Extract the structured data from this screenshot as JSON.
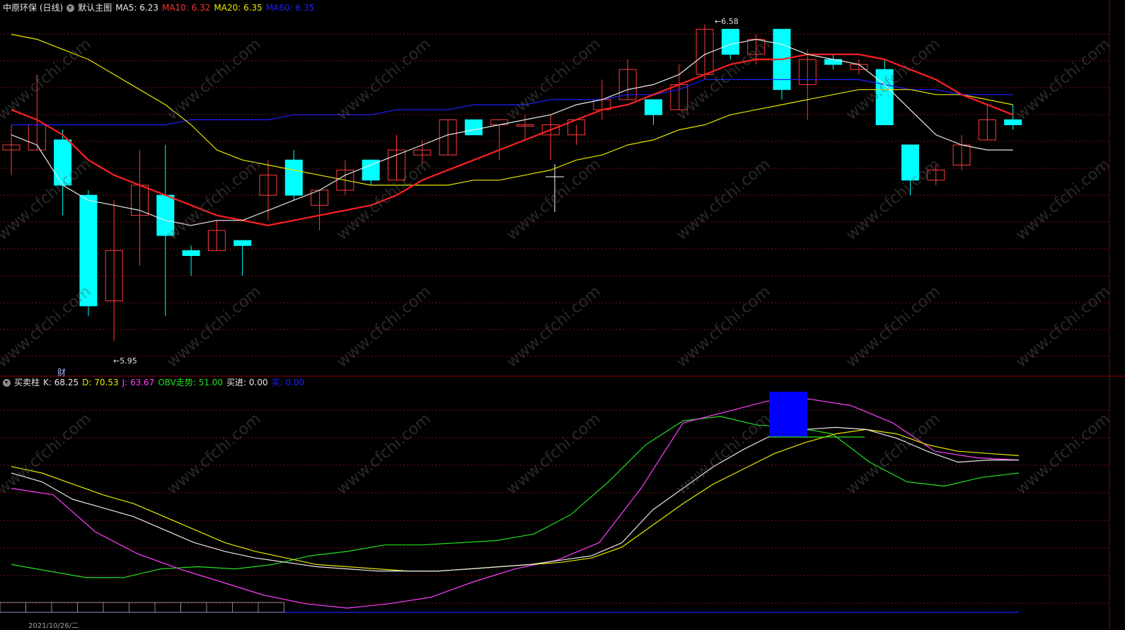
{
  "header_main": {
    "title": "中原环保 (日线)",
    "template": "默认主图",
    "ma5": "MA5: 6.23",
    "ma10": "MA10: 6.32",
    "ma20": "MA20: 6.35",
    "ma60": "MA60: 6.35"
  },
  "header_sub": {
    "name": "买卖柱",
    "k": "K: 68.25",
    "d": "D: 70.53",
    "j": "J: 63.67",
    "obv": "OBV走势: 51.00",
    "buy_in": "买进: 0.00",
    "buy": "买: 0.00"
  },
  "annotations": {
    "high_label": "6.58",
    "low_label": "5.95",
    "finance_marker": "财",
    "date_label": "2021/10/26/二"
  },
  "watermark": "www.cfchi.com",
  "colors": {
    "up_candle": "#ff3a3a",
    "down_candle": "#00ffff",
    "ma5": "#e8e8e8",
    "ma10": "#ff2020",
    "ma20": "#e8e800",
    "ma60": "#2020ff",
    "k": "#e8e8e8",
    "d": "#e8e800",
    "j": "#ff40ff",
    "obv": "#20e020",
    "buy_bar": "#0000ff",
    "grid": "#7a1010"
  },
  "chart_data": [
    {
      "type": "candlestick",
      "ylim": [
        5.9,
        6.6
      ],
      "candles": [
        {
          "o": 6.33,
          "h": 6.38,
          "l": 6.28,
          "c": 6.34
        },
        {
          "o": 6.33,
          "h": 6.48,
          "l": 6.33,
          "c": 6.38
        },
        {
          "o": 6.35,
          "h": 6.37,
          "l": 6.2,
          "c": 6.26
        },
        {
          "o": 6.24,
          "h": 6.25,
          "l": 6.0,
          "c": 6.02
        },
        {
          "o": 6.03,
          "h": 6.23,
          "l": 5.95,
          "c": 6.13
        },
        {
          "o": 6.2,
          "h": 6.33,
          "l": 6.1,
          "c": 6.26
        },
        {
          "o": 6.24,
          "h": 6.34,
          "l": 6.0,
          "c": 6.16
        },
        {
          "o": 6.13,
          "h": 6.14,
          "l": 6.08,
          "c": 6.12
        },
        {
          "o": 6.13,
          "h": 6.19,
          "l": 6.13,
          "c": 6.17
        },
        {
          "o": 6.15,
          "h": 6.15,
          "l": 6.08,
          "c": 6.14
        },
        {
          "o": 6.24,
          "h": 6.31,
          "l": 6.19,
          "c": 6.28
        },
        {
          "o": 6.31,
          "h": 6.33,
          "l": 6.23,
          "c": 6.24
        },
        {
          "o": 6.22,
          "h": 6.25,
          "l": 6.17,
          "c": 6.25
        },
        {
          "o": 6.25,
          "h": 6.31,
          "l": 6.24,
          "c": 6.29
        },
        {
          "o": 6.31,
          "h": 6.31,
          "l": 6.26,
          "c": 6.27
        },
        {
          "o": 6.27,
          "h": 6.36,
          "l": 6.27,
          "c": 6.33
        },
        {
          "o": 6.32,
          "h": 6.35,
          "l": 6.3,
          "c": 6.33
        },
        {
          "o": 6.32,
          "h": 6.39,
          "l": 6.32,
          "c": 6.39
        },
        {
          "o": 6.39,
          "h": 6.39,
          "l": 6.36,
          "c": 6.36
        },
        {
          "o": 6.38,
          "h": 6.38,
          "l": 6.31,
          "c": 6.39
        },
        {
          "o": 6.38,
          "h": 6.4,
          "l": 6.35,
          "c": 6.38
        },
        {
          "o": 6.36,
          "h": 6.4,
          "l": 6.31,
          "c": 6.38
        },
        {
          "o": 6.36,
          "h": 6.38,
          "l": 6.34,
          "c": 6.39
        },
        {
          "o": 6.41,
          "h": 6.47,
          "l": 6.39,
          "c": 6.43
        },
        {
          "o": 6.43,
          "h": 6.51,
          "l": 6.43,
          "c": 6.49
        },
        {
          "o": 6.43,
          "h": 6.43,
          "l": 6.38,
          "c": 6.4
        },
        {
          "o": 6.41,
          "h": 6.5,
          "l": 6.41,
          "c": 6.46
        },
        {
          "o": 6.48,
          "h": 6.58,
          "l": 6.47,
          "c": 6.57
        },
        {
          "o": 6.57,
          "h": 6.57,
          "l": 6.51,
          "c": 6.52
        },
        {
          "o": 6.52,
          "h": 6.56,
          "l": 6.5,
          "c": 6.55
        },
        {
          "o": 6.57,
          "h": 6.57,
          "l": 6.43,
          "c": 6.45
        },
        {
          "o": 6.46,
          "h": 6.53,
          "l": 6.39,
          "c": 6.51
        },
        {
          "o": 6.51,
          "h": 6.52,
          "l": 6.49,
          "c": 6.5
        },
        {
          "o": 6.49,
          "h": 6.51,
          "l": 6.48,
          "c": 6.5
        },
        {
          "o": 6.49,
          "h": 6.51,
          "l": 6.38,
          "c": 6.38
        },
        {
          "o": 6.34,
          "h": 6.34,
          "l": 6.24,
          "c": 6.27
        },
        {
          "o": 6.27,
          "h": 6.3,
          "l": 6.26,
          "c": 6.29
        },
        {
          "o": 6.3,
          "h": 6.36,
          "l": 6.29,
          "c": 6.34
        },
        {
          "o": 6.35,
          "h": 6.42,
          "l": 6.35,
          "c": 6.39
        },
        {
          "o": 6.39,
          "h": 6.42,
          "l": 6.37,
          "c": 6.38
        }
      ],
      "ma5": [
        6.36,
        6.34,
        6.26,
        6.23,
        6.22,
        6.21,
        6.19,
        6.18,
        6.19,
        6.19,
        6.21,
        6.23,
        6.25,
        6.28,
        6.3,
        6.32,
        6.34,
        6.36,
        6.37,
        6.38,
        6.39,
        6.4,
        6.42,
        6.43,
        6.45,
        6.46,
        6.48,
        6.52,
        6.54,
        6.55,
        6.54,
        6.52,
        6.51,
        6.5,
        6.46,
        6.41,
        6.36,
        6.34,
        6.33,
        6.33
      ],
      "ma10": [
        6.41,
        6.39,
        6.36,
        6.31,
        6.28,
        6.26,
        6.24,
        6.22,
        6.2,
        6.19,
        6.18,
        6.19,
        6.2,
        6.21,
        6.22,
        6.24,
        6.27,
        6.29,
        6.31,
        6.33,
        6.35,
        6.37,
        6.39,
        6.41,
        6.42,
        6.44,
        6.46,
        6.48,
        6.5,
        6.51,
        6.51,
        6.52,
        6.52,
        6.52,
        6.51,
        6.49,
        6.47,
        6.44,
        6.42,
        6.4
      ],
      "ma20": [
        6.56,
        6.55,
        6.53,
        6.51,
        6.48,
        6.45,
        6.42,
        6.38,
        6.33,
        6.31,
        6.3,
        6.29,
        6.28,
        6.27,
        6.26,
        6.26,
        6.26,
        6.26,
        6.27,
        6.27,
        6.28,
        6.29,
        6.31,
        6.32,
        6.34,
        6.35,
        6.37,
        6.38,
        6.4,
        6.41,
        6.42,
        6.43,
        6.44,
        6.45,
        6.45,
        6.45,
        6.44,
        6.44,
        6.43,
        6.42
      ],
      "ma60": [
        6.38,
        6.38,
        6.38,
        6.38,
        6.38,
        6.38,
        6.38,
        6.39,
        6.39,
        6.39,
        6.39,
        6.4,
        6.4,
        6.4,
        6.4,
        6.41,
        6.41,
        6.41,
        6.42,
        6.42,
        6.42,
        6.43,
        6.43,
        6.43,
        6.44,
        6.44,
        6.45,
        6.47,
        6.47,
        6.47,
        6.47,
        6.47,
        6.47,
        6.47,
        6.46,
        6.45,
        6.45,
        6.44,
        6.44,
        6.44
      ]
    },
    {
      "type": "line",
      "ylim": [
        0,
        100
      ],
      "k": [
        62,
        58,
        50,
        46,
        42,
        36,
        30,
        26,
        23,
        21,
        19,
        18,
        17,
        17,
        17,
        18,
        19,
        20,
        22,
        24,
        30,
        45,
        55,
        65,
        73,
        80,
        82,
        83,
        82,
        78,
        72,
        67,
        68,
        68
      ],
      "d": [
        65,
        62,
        57,
        52,
        48,
        42,
        36,
        30,
        26,
        23,
        20,
        19,
        18,
        17,
        17,
        18,
        19,
        20,
        21,
        23,
        28,
        38,
        48,
        57,
        64,
        71,
        76,
        80,
        82,
        80,
        75,
        72,
        71,
        70
      ],
      "j": [
        55,
        52,
        35,
        25,
        18,
        12,
        6,
        2,
        0,
        2,
        5,
        12,
        18,
        22,
        30,
        55,
        85,
        90,
        95,
        96,
        93,
        85,
        72,
        69,
        68
      ],
      "obv": [
        20,
        17,
        14,
        14,
        18,
        19,
        18,
        20,
        24,
        26,
        29,
        29,
        30,
        31,
        34,
        43,
        58,
        75,
        86,
        88,
        84,
        83,
        80,
        67,
        58,
        56,
        60,
        62
      ]
    }
  ]
}
